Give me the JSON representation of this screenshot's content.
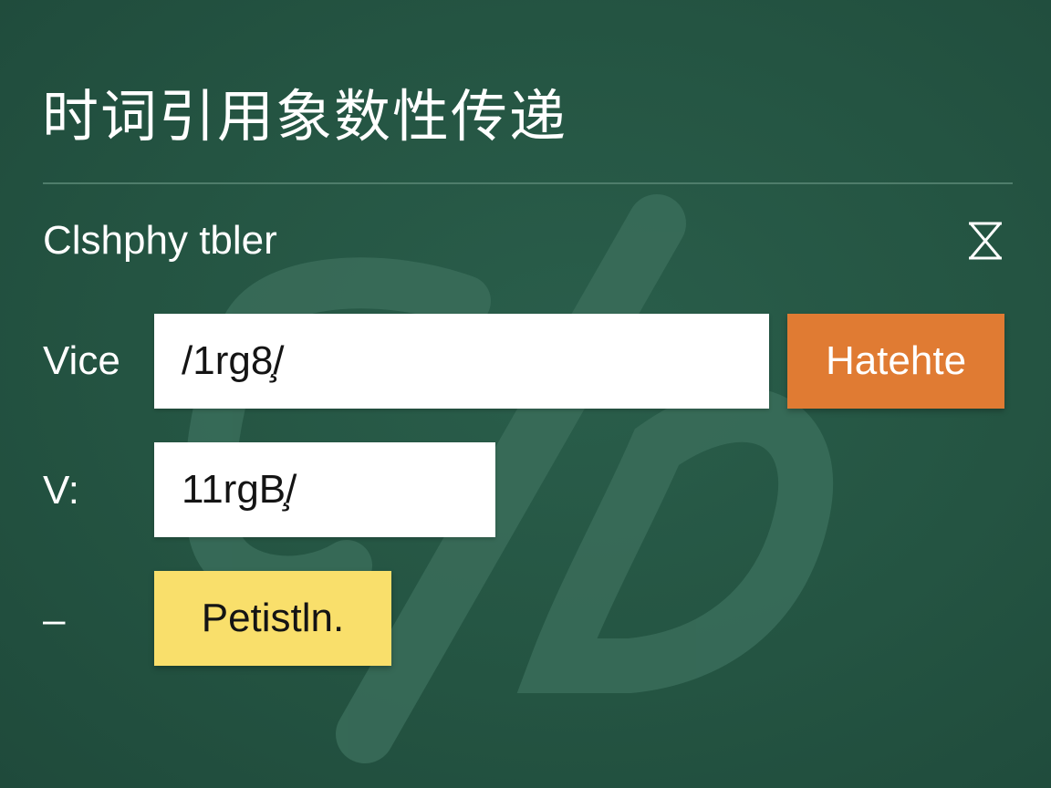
{
  "page": {
    "title": "时词引用象数性传递",
    "subtitle": "Clshphy tbler"
  },
  "form": {
    "rows": [
      {
        "label": "Vice",
        "value": "/1rg8̧/"
      },
      {
        "label": "V:",
        "value": "11rgB̧/"
      },
      {
        "label": "–"
      }
    ],
    "primary_button": "Hatehte",
    "secondary_button": "Petistln."
  },
  "icons": {
    "close": "hourglass-close-icon"
  },
  "colors": {
    "background": "#245442",
    "primary_accent": "#e07b33",
    "secondary_accent": "#f9df6b",
    "field_background": "#ffffff"
  }
}
